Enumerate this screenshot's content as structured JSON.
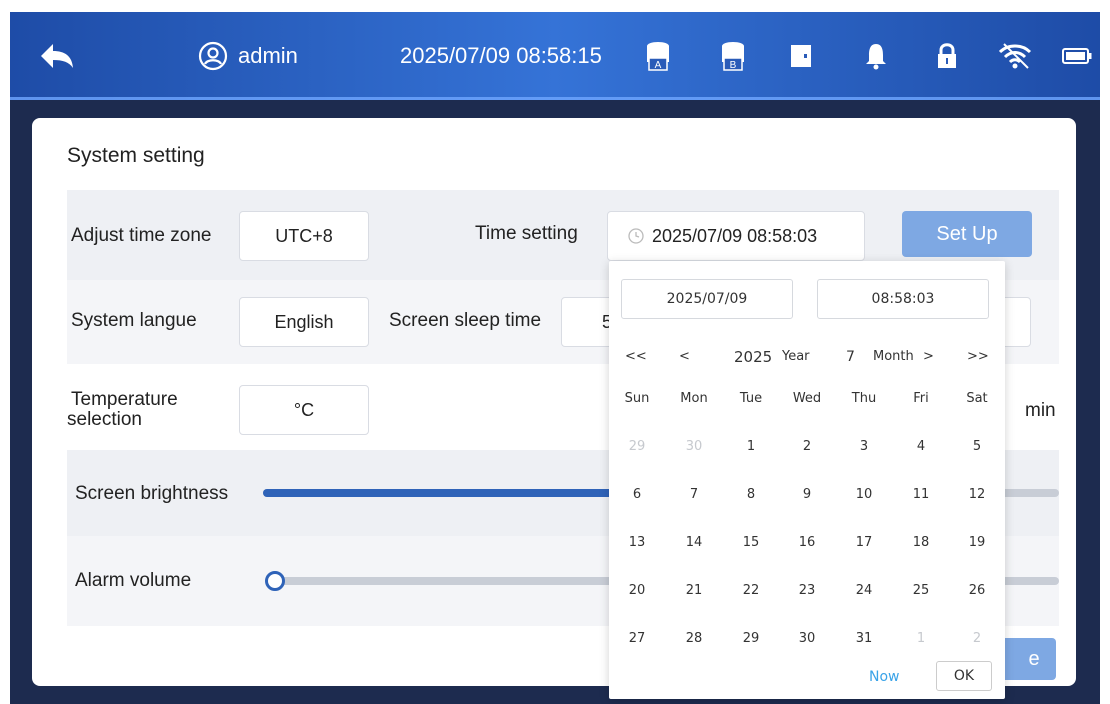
{
  "topbar": {
    "user": "admin",
    "datetime": "2025/07/09 08:58:15",
    "icons": [
      "back-arrow-icon",
      "user-circle-icon",
      "storage-a-icon",
      "storage-b-icon",
      "door-icon",
      "bell-icon",
      "lock-icon",
      "wifi-icon",
      "battery-icon"
    ],
    "drive_a": "A",
    "drive_b": "B"
  },
  "panel": {
    "title": "System setting",
    "timezone_label": "Adjust time zone",
    "timezone_value": "UTC+8",
    "time_setting_label": "Time setting",
    "time_setting_value": "2025/07/09 08:58:03",
    "setup_button": "Set Up",
    "language_label": "System langue",
    "language_value": "English",
    "sleep_label": "Screen sleep time",
    "sleep_value_partial": "5",
    "temp_label_line1": "Temperature",
    "temp_label_line2": "selection",
    "temp_value": "°C",
    "temp_unit_partial": "min",
    "brightness_label": "Screen brightness",
    "brightness_level": 0.6,
    "volume_label": "Alarm volume",
    "volume_level": 0.0,
    "save_button_partial": "e"
  },
  "picker": {
    "date_value": "2025/07/09",
    "time_value": "08:58:03",
    "nav_prev_year": "<<",
    "nav_prev_month": "<",
    "year": "2025",
    "year_label": "Year",
    "month": "7",
    "month_label": "Month",
    "nav_next_month": ">",
    "nav_next_year": ">>",
    "weekdays": [
      "Sun",
      "Mon",
      "Tue",
      "Wed",
      "Thu",
      "Fri",
      "Sat"
    ],
    "weeks": [
      [
        {
          "d": "29",
          "dim": true
        },
        {
          "d": "30",
          "dim": true
        },
        {
          "d": "1"
        },
        {
          "d": "2"
        },
        {
          "d": "3"
        },
        {
          "d": "4"
        },
        {
          "d": "5"
        }
      ],
      [
        {
          "d": "6"
        },
        {
          "d": "7"
        },
        {
          "d": "8"
        },
        {
          "d": "9"
        },
        {
          "d": "10"
        },
        {
          "d": "11"
        },
        {
          "d": "12"
        }
      ],
      [
        {
          "d": "13"
        },
        {
          "d": "14"
        },
        {
          "d": "15"
        },
        {
          "d": "16"
        },
        {
          "d": "17"
        },
        {
          "d": "18"
        },
        {
          "d": "19"
        }
      ],
      [
        {
          "d": "20"
        },
        {
          "d": "21"
        },
        {
          "d": "22"
        },
        {
          "d": "23"
        },
        {
          "d": "24"
        },
        {
          "d": "25"
        },
        {
          "d": "26"
        }
      ],
      [
        {
          "d": "27"
        },
        {
          "d": "28"
        },
        {
          "d": "29"
        },
        {
          "d": "30"
        },
        {
          "d": "31"
        },
        {
          "d": "1",
          "dim": true
        },
        {
          "d": "2",
          "dim": true
        }
      ]
    ],
    "now_label": "Now",
    "ok_label": "OK"
  },
  "colors": {
    "topbar": "#3573d7",
    "accent": "#2f63b8",
    "button": "#7ea8e3",
    "link": "#3aa3e8"
  }
}
